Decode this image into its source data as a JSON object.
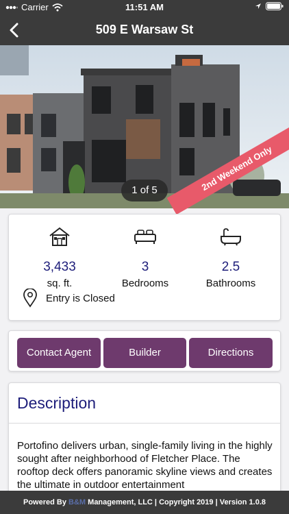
{
  "status_bar": {
    "carrier": "Carrier",
    "time": "11:51 AM"
  },
  "header": {
    "title": "509 E Warsaw St"
  },
  "hero": {
    "photo_counter": "1 of 5",
    "ribbon_text": "2nd Weekend Only"
  },
  "stats": {
    "sqft": {
      "value": "3,433",
      "label": "sq. ft."
    },
    "bedrooms": {
      "value": "3",
      "label": "Bedrooms"
    },
    "bathrooms": {
      "value": "2.5",
      "label": "Bathrooms"
    },
    "entry_status": "Entry is Closed"
  },
  "actions": {
    "contact": "Contact Agent",
    "builder": "Builder",
    "directions": "Directions"
  },
  "description": {
    "title": "Description",
    "text": "Portofino delivers urban, single-family living in the highly sought after neighborhood of Fletcher Place. The rooftop deck offers panoramic skyline views and creates the ultimate in outdoor entertainment"
  },
  "footer": {
    "powered_by": "Powered By ",
    "brand": "B&M",
    "rest": " Management, LLC | Copyright 2019 | Version 1.0.8"
  },
  "colors": {
    "accent_purple": "#6e3a6d",
    "value_blue": "#1d1d7a",
    "ribbon": "#e85a6a",
    "bar": "#3b3b3b"
  }
}
